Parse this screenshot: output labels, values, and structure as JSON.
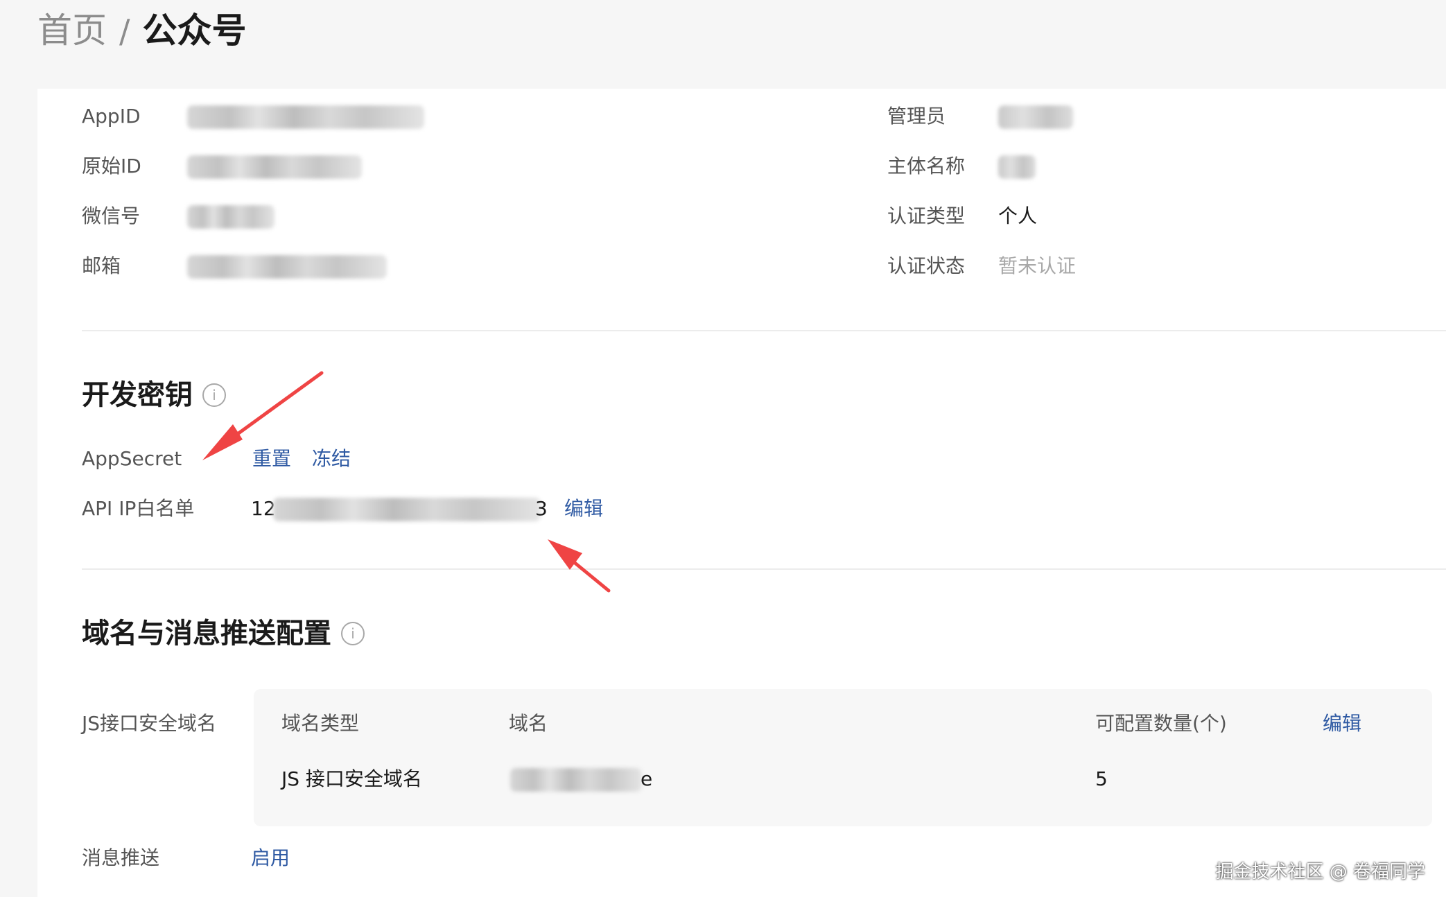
{
  "breadcrumb": {
    "home": "首页",
    "separator": "/",
    "current": "公众号"
  },
  "account_info": {
    "left": [
      {
        "label": "AppID",
        "value": ""
      },
      {
        "label": "原始ID",
        "value": ""
      },
      {
        "label": "微信号",
        "value": ""
      },
      {
        "label": "邮箱",
        "value": ""
      }
    ],
    "right": [
      {
        "label": "管理员",
        "value": ""
      },
      {
        "label": "主体名称",
        "value": ""
      },
      {
        "label": "认证类型",
        "value": "个人"
      },
      {
        "label": "认证状态",
        "value": "暂未认证"
      }
    ]
  },
  "dev_keys": {
    "title": "开发密钥",
    "info_icon": "i",
    "appsecret_label": "AppSecret",
    "reset_link": "重置",
    "freeze_link": "冻结",
    "ip_whitelist_label": "API IP白名单",
    "ip_whitelist_prefix": "12",
    "ip_whitelist_suffix": "3",
    "ip_edit_link": "编辑"
  },
  "domain_config": {
    "title": "域名与消息推送配置",
    "info_icon": "i",
    "js_domain_label": "JS接口安全域名",
    "table_headers": {
      "type": "域名类型",
      "domain": "域名",
      "count": "可配置数量(个)",
      "edit": "编辑"
    },
    "table_row": {
      "type": "JS 接口安全域名",
      "domain_suffix": "e",
      "count": "5"
    },
    "message_push_label": "消息推送",
    "message_push_link": "启用"
  },
  "watermark": "掘金技术社区 @ 卷福同学",
  "colors": {
    "link": "#2f5aa3",
    "arrow": "#ef4444",
    "muted": "#a8a8a8"
  }
}
